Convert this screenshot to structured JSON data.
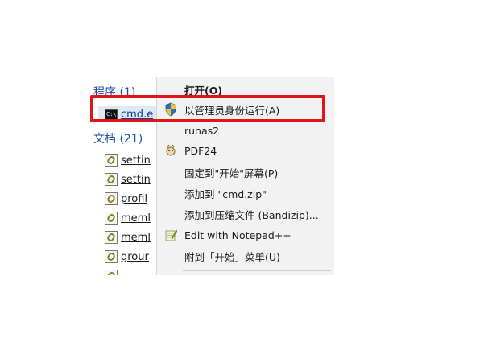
{
  "search_results": {
    "programs_heading": "程序 (1)",
    "programs": [
      {
        "name": "cmd.e",
        "icon": "cmd-icon"
      }
    ],
    "documents_heading": "文档 (21)",
    "documents": [
      {
        "name": "settin",
        "icon": "config-file-icon"
      },
      {
        "name": "settin",
        "icon": "config-file-icon"
      },
      {
        "name": "profil",
        "icon": "config-file-icon"
      },
      {
        "name": "meml",
        "icon": "config-file-icon"
      },
      {
        "name": "meml",
        "icon": "config-file-icon"
      },
      {
        "name": "grour",
        "icon": "config-file-icon"
      }
    ]
  },
  "context_menu": {
    "items": [
      {
        "label": "打开(O)",
        "bold": true,
        "icon": ""
      },
      {
        "label": "以管理员身份运行(A)",
        "bold": false,
        "icon": "uac-shield-icon"
      },
      {
        "label": "runas2",
        "bold": false,
        "icon": ""
      },
      {
        "label": "PDF24",
        "bold": false,
        "icon": "pdf24-icon"
      },
      {
        "label": "固定到\"开始\"屏幕(P)",
        "bold": false,
        "icon": ""
      },
      {
        "label": "添加到 \"cmd.zip\"",
        "bold": false,
        "icon": ""
      },
      {
        "label": "添加到压缩文件 (Bandizip)...",
        "bold": false,
        "icon": ""
      },
      {
        "label": "Edit with Notepad++",
        "bold": false,
        "icon": "notepad-plus-plus-icon"
      },
      {
        "label": "附到「开始」菜单(U)",
        "bold": false,
        "icon": ""
      }
    ]
  },
  "annotation": {
    "highlight_color": "#e0151b",
    "highlight_target": "以管理员身份运行(A)"
  },
  "colors": {
    "heading_blue": "#1f4e9a",
    "link_blue": "#0b3d91",
    "menu_bg": "#f2f2f2"
  }
}
